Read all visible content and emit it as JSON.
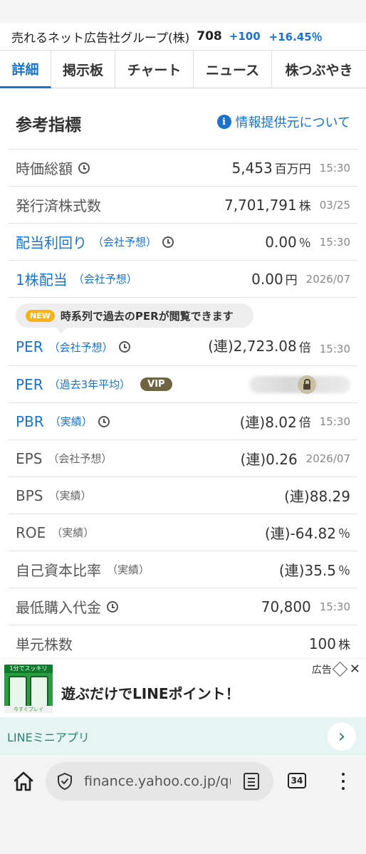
{
  "stock": {
    "name": "売れるネット広告社グループ(株)",
    "price": "708",
    "change": "+100",
    "change_pct": "+16.45％"
  },
  "tabs": [
    "詳細",
    "掲示板",
    "チャート",
    "ニュース",
    "株つぶやき"
  ],
  "section": {
    "title": "参考指標",
    "info_link": "情報提供元について"
  },
  "indicators": {
    "market_cap": {
      "label": "時価総額",
      "value": "5,453",
      "unit": "百万円",
      "time": "15:30"
    },
    "shares_issued": {
      "label": "発行済株式数",
      "value": "7,701,791",
      "unit": "株",
      "time": "03/25"
    },
    "dividend_yield": {
      "label": "配当利回り",
      "sub": "（会社予想）",
      "value": "0.00",
      "unit": "％",
      "time": "15:30"
    },
    "dividend_per_share": {
      "label": "1株配当",
      "sub": "（会社予想）",
      "value": "0.00",
      "unit": "円",
      "time": "2026/07"
    },
    "per_forecast": {
      "label": "PER",
      "sub": "（会社予想）",
      "value": "(連)2,723.08",
      "unit": "倍",
      "time": "15:30"
    },
    "per_3y": {
      "label": "PER",
      "sub": "（過去3年平均）",
      "badge": "VIP"
    },
    "pbr": {
      "label": "PBR",
      "sub": "（実績）",
      "value": "(連)8.02",
      "unit": "倍",
      "time": "15:30"
    },
    "eps": {
      "label": "EPS",
      "sub": "（会社予想）",
      "value": "(連)0.26",
      "time": "2026/07"
    },
    "bps": {
      "label": "BPS",
      "sub": "（実績）",
      "value": "(連)88.29"
    },
    "roe": {
      "label": "ROE",
      "sub": "（実績）",
      "value": "(連)-64.82",
      "unit": "％"
    },
    "equity_ratio": {
      "label": "自己資本比率",
      "sub": "（実績）",
      "value": "(連)35.5",
      "unit": "％"
    },
    "min_purchase": {
      "label": "最低購入代金",
      "value": "70,800",
      "time": "15:30"
    },
    "unit_shares": {
      "label": "単元株数",
      "value": "100",
      "unit": "株"
    }
  },
  "per_notice": {
    "badge": "NEW",
    "text": "時系列で過去のPERが閲覧できます"
  },
  "ad": {
    "label": "広告",
    "headline": "遊ぶだけでLINEポイント！",
    "thumb_top": "1分でスッキリ",
    "thumb_bottom": "今すぐプレイ",
    "bar_text": "LINEミニアプリ"
  },
  "browser": {
    "url": "finance.yahoo.co.jp/qu",
    "tab_count": "34"
  },
  "colors": {
    "accent": "#1a73c8",
    "new_badge": "#f5b417",
    "vip": "#6e6440",
    "ad_bar": "#e6f4f2"
  }
}
